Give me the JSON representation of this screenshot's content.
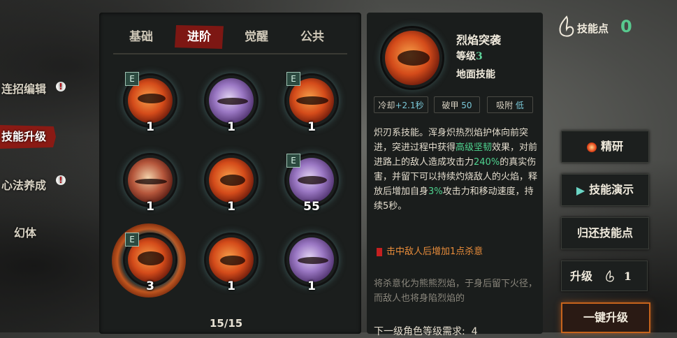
{
  "left_menu": {
    "items": [
      {
        "label": "连招编辑",
        "alert": "!"
      },
      {
        "label": "技能升级",
        "alert": ""
      },
      {
        "label": "心法养成",
        "alert": "!"
      },
      {
        "label": "幻体",
        "alert": ""
      }
    ]
  },
  "tabs": [
    "基础",
    "进阶",
    "觉醒",
    "公共"
  ],
  "active_tab": "进阶",
  "skills": [
    {
      "level": "1",
      "badge": "E",
      "color": "orange"
    },
    {
      "level": "1",
      "badge": "",
      "color": "purple"
    },
    {
      "level": "1",
      "badge": "E",
      "color": "orange"
    },
    {
      "level": "1",
      "badge": "",
      "color": "pale"
    },
    {
      "level": "1",
      "badge": "",
      "color": "orange"
    },
    {
      "level": "55",
      "badge": "E",
      "color": "purple"
    },
    {
      "level": "3",
      "badge": "E",
      "color": "orange"
    },
    {
      "level": "1",
      "badge": "",
      "color": "orange"
    },
    {
      "level": "1",
      "badge": "",
      "color": "purple"
    }
  ],
  "page_count": "15/15",
  "detail": {
    "name": "烈焰突袭",
    "level_label": "等级",
    "level_value": "3",
    "type": "地面技能",
    "stats": {
      "cooldown_label": "冷却",
      "cooldown_value": "+2.1秒",
      "armor_label": "破甲",
      "armor_value": "50",
      "absorb_label": "吸附",
      "absorb_value": "低"
    },
    "desc": {
      "p1": "炽刃系技能。浑身炽热烈焰护体向前突进，突进过程中获得",
      "hl1": "高级坚韧",
      "p2": "效果，对前进路上的敌人造成攻击力",
      "hl2": "240%",
      "p3": "的真实伤害，并留下可以持续灼烧敌人的火焰，释放后增加自身",
      "hl3": "3%",
      "p4": "攻击力和移动速度，持续5秒。"
    },
    "bonus": "击中敌人后增加1点杀意",
    "lore": "将杀意化为熊熊烈焰，于身后留下火径，而敌人也将身陷烈焰的",
    "requirement_label": "下一级角色等级需求:",
    "requirement_value": "4"
  },
  "skill_points": {
    "label": "技能点",
    "value": "0"
  },
  "buttons": {
    "research": "精研",
    "demo": "技能演示",
    "refund": "归还技能点",
    "upgrade_label": "升级",
    "upgrade_cost": "1",
    "one_click": "一键升级"
  },
  "colors": {
    "accent_red": "#8a1a14",
    "green": "#4fd38f",
    "orange": "#e88c3a"
  }
}
